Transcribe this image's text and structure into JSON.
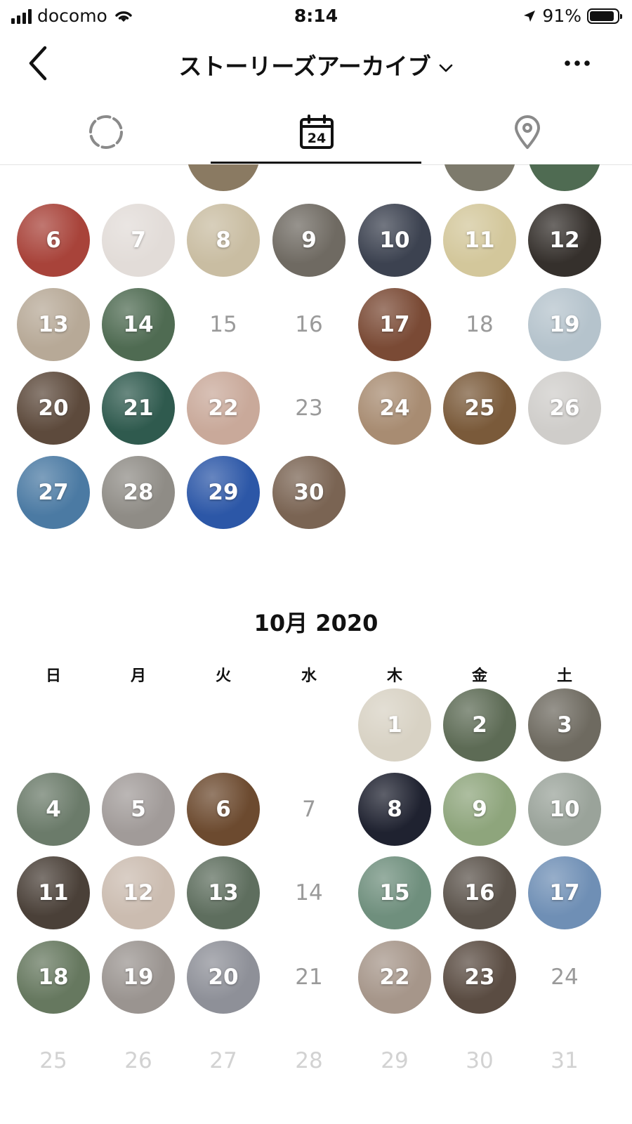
{
  "status_bar": {
    "carrier": "docomo",
    "time": "8:14",
    "battery": "91%"
  },
  "nav": {
    "title": "ストーリーズアーカイブ"
  },
  "tabs": [
    {
      "name": "archive",
      "icon": "story-circle-icon"
    },
    {
      "name": "calendar",
      "icon": "calendar-icon",
      "badge": "24"
    },
    {
      "name": "map",
      "icon": "location-pin-icon"
    }
  ],
  "september": {
    "days": [
      {
        "d": "6",
        "story": true,
        "color": "#a8433a"
      },
      {
        "d": "7",
        "story": true,
        "color": "#e2dcd8"
      },
      {
        "d": "8",
        "story": true,
        "color": "#c9bda2"
      },
      {
        "d": "9",
        "story": true,
        "color": "#6f6a62"
      },
      {
        "d": "10",
        "story": true,
        "color": "#3c4250"
      },
      {
        "d": "11",
        "story": true,
        "color": "#d3c79b"
      },
      {
        "d": "12",
        "story": true,
        "color": "#35302c"
      },
      {
        "d": "13",
        "story": true,
        "color": "#b7a997"
      },
      {
        "d": "14",
        "story": true,
        "color": "#4f6b52"
      },
      {
        "d": "15",
        "story": false
      },
      {
        "d": "16",
        "story": false
      },
      {
        "d": "17",
        "story": true,
        "color": "#7a4a35"
      },
      {
        "d": "18",
        "story": false
      },
      {
        "d": "19",
        "story": true,
        "color": "#b5c3cc"
      },
      {
        "d": "20",
        "story": true,
        "color": "#5d4a3c"
      },
      {
        "d": "21",
        "story": true,
        "color": "#2f5a4e"
      },
      {
        "d": "22",
        "story": true,
        "color": "#c9a99a"
      },
      {
        "d": "23",
        "story": false
      },
      {
        "d": "24",
        "story": true,
        "color": "#a88c72"
      },
      {
        "d": "25",
        "story": true,
        "color": "#7a5a3a"
      },
      {
        "d": "26",
        "story": true,
        "color": "#cfcdca"
      },
      {
        "d": "27",
        "story": true,
        "color": "#4b7aa3"
      },
      {
        "d": "28",
        "story": true,
        "color": "#8f8c86"
      },
      {
        "d": "29",
        "story": true,
        "color": "#2c57a7"
      },
      {
        "d": "30",
        "story": true,
        "color": "#7a6453"
      }
    ]
  },
  "october": {
    "title": "10月 2020",
    "weekdays": [
      "日",
      "月",
      "火",
      "水",
      "木",
      "金",
      "土"
    ],
    "days": [
      {
        "d": "1",
        "story": true,
        "color": "#d8d2c4"
      },
      {
        "d": "2",
        "story": true,
        "color": "#5d6b55"
      },
      {
        "d": "3",
        "story": true,
        "color": "#6e6a60"
      },
      {
        "d": "4",
        "story": true,
        "color": "#6b7b6a"
      },
      {
        "d": "5",
        "story": true,
        "color": "#a19b99"
      },
      {
        "d": "6",
        "story": true,
        "color": "#6c4a2f"
      },
      {
        "d": "7",
        "story": false
      },
      {
        "d": "8",
        "story": true,
        "color": "#1f2230"
      },
      {
        "d": "9",
        "story": true,
        "color": "#8ea57c"
      },
      {
        "d": "10",
        "story": true,
        "color": "#9aa39a"
      },
      {
        "d": "11",
        "story": true,
        "color": "#4a4038"
      },
      {
        "d": "12",
        "story": true,
        "color": "#cbbcb0"
      },
      {
        "d": "13",
        "story": true,
        "color": "#5e6e5e"
      },
      {
        "d": "14",
        "story": false
      },
      {
        "d": "15",
        "story": true,
        "color": "#6f8f7d"
      },
      {
        "d": "16",
        "story": true,
        "color": "#5b534b"
      },
      {
        "d": "17",
        "story": true,
        "color": "#6f8fb5"
      },
      {
        "d": "18",
        "story": true,
        "color": "#66785f"
      },
      {
        "d": "19",
        "story": true,
        "color": "#9a9490"
      },
      {
        "d": "20",
        "story": true,
        "color": "#8e9098"
      },
      {
        "d": "21",
        "story": false
      },
      {
        "d": "22",
        "story": true,
        "color": "#a6968a"
      },
      {
        "d": "23",
        "story": true,
        "color": "#5a4c42"
      },
      {
        "d": "24",
        "story": false
      },
      {
        "d": "25",
        "future": true
      },
      {
        "d": "26",
        "future": true
      },
      {
        "d": "27",
        "future": true
      },
      {
        "d": "28",
        "future": true
      },
      {
        "d": "29",
        "future": true
      },
      {
        "d": "30",
        "future": true
      },
      {
        "d": "31",
        "future": true
      }
    ]
  }
}
